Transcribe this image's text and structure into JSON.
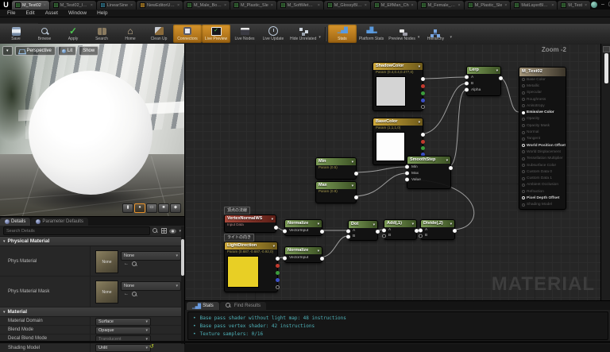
{
  "window": {
    "logo": "U",
    "tabs": [
      {
        "label": "M_Test02",
        "active": true
      },
      {
        "label": "M_Test02_Inst",
        "active": false
      },
      {
        "label": "LinearSine",
        "active": false
      },
      {
        "label": "NewEditorUtility",
        "active": false
      },
      {
        "label": "M_Male_Body",
        "active": false
      },
      {
        "label": "M_Plastic_Sle",
        "active": false
      },
      {
        "label": "M_SoftMetal_+",
        "active": false
      },
      {
        "label": "M_GlossyBla+",
        "active": false
      },
      {
        "label": "M_ElfMan_Ch",
        "active": false
      },
      {
        "label": "M_Female_Bo+",
        "active": false
      },
      {
        "label": "M_Plastic_Sle",
        "active": false
      },
      {
        "label": "MatLayerBlend",
        "active": false
      },
      {
        "label": "M_Test",
        "active": false
      }
    ],
    "menu": [
      {
        "label": "File"
      },
      {
        "label": "Edit"
      },
      {
        "label": "Asset"
      },
      {
        "label": "Window"
      },
      {
        "label": "Help"
      }
    ],
    "toolbar_tab": "Toolbar",
    "toolbar": [
      {
        "label": "Save"
      },
      {
        "label": "Browse"
      },
      {
        "label": "Apply"
      },
      {
        "label": "Search"
      },
      {
        "label": "Home"
      },
      {
        "label": "Clean Up"
      },
      {
        "label": "Connectors",
        "active": true
      },
      {
        "label": "Live Preview",
        "active": true
      },
      {
        "label": "Live Nodes"
      },
      {
        "label": "Live Update"
      },
      {
        "label": "Hide Unrelated"
      },
      {
        "label": "Stats",
        "active": true
      },
      {
        "label": "Platform Stats"
      },
      {
        "label": "Preview Nodes"
      },
      {
        "label": "Hierarchy"
      }
    ]
  },
  "viewport": {
    "buttons": {
      "perspective": "Perspective",
      "lit": "Lit",
      "show": "Show"
    }
  },
  "details": {
    "tabs": [
      {
        "label": "Details",
        "active": true
      },
      {
        "label": "Parameter Defaults",
        "active": false
      }
    ],
    "search_placeholder": "Search Details",
    "sections": [
      {
        "header": "Physical Material"
      },
      {
        "header": "Material"
      }
    ],
    "phys_rows": [
      {
        "label": "Phys Material",
        "thumb": "None",
        "value": "None"
      },
      {
        "label": "Phys Material Mask",
        "thumb": "None",
        "value": "None"
      }
    ],
    "mat_rows": [
      {
        "label": "Material Domain",
        "value": "Surface"
      },
      {
        "label": "Blend Mode",
        "value": "Opaque"
      },
      {
        "label": "Decal Blend Mode",
        "value": "Translucent"
      },
      {
        "label": "Shading Model",
        "value": "Unlit"
      }
    ]
  },
  "graph": {
    "zoom_label": "Zoom -2",
    "watermark": "MATERIAL",
    "comments": {
      "vertex_normal": "頂点の法線",
      "light_direction": "ライトの向き"
    },
    "nodes": {
      "shadow_color": {
        "title": "ShadowColor",
        "subtitle": "Param (0.4,0.4,0.477,0)"
      },
      "lerp": {
        "title": "Lerp",
        "pins": [
          "A",
          "B",
          "Alpha"
        ]
      },
      "base_color": {
        "title": "BaseColor",
        "subtitle": "Param (1,1,1,0)"
      },
      "min": {
        "title": "Min",
        "subtitle": "Param (0.5)"
      },
      "max": {
        "title": "Max",
        "subtitle": "Param (0.9)"
      },
      "smoothstep": {
        "title": "SmoothStep",
        "pins": [
          "Min",
          "Max",
          "Value"
        ]
      },
      "vertex_normal": {
        "title": "VertexNormalWS",
        "subtitle": "Input Data"
      },
      "normalize1": {
        "title": "Normalize",
        "pin": "VectorInput"
      },
      "dot": {
        "title": "Dot",
        "pins": [
          "A",
          "B"
        ]
      },
      "add": {
        "title": "Add(,1)",
        "pins": [
          "A",
          "B"
        ]
      },
      "divide": {
        "title": "Divide(,2)",
        "pins": [
          "A",
          "B"
        ]
      },
      "light_direction": {
        "title": "LightDirection",
        "subtitle": "Param (0.687,-0.687,-0.92,0)"
      },
      "normalize2": {
        "title": "Normalize",
        "pin": "VectorInput"
      }
    },
    "output_node": {
      "title": "M_Test02",
      "pins": [
        {
          "label": "Base Color",
          "state": "off"
        },
        {
          "label": "Metallic",
          "state": "off"
        },
        {
          "label": "Specular",
          "state": "off"
        },
        {
          "label": "Roughness",
          "state": "off"
        },
        {
          "label": "Anisotropy",
          "state": "off"
        },
        {
          "label": "Emissive Color",
          "state": "on"
        },
        {
          "label": "Opacity",
          "state": "off"
        },
        {
          "label": "Opacity Mask",
          "state": "off"
        },
        {
          "label": "Normal",
          "state": "off"
        },
        {
          "label": "Tangent",
          "state": "off"
        },
        {
          "label": "World Position Offset",
          "state": "enabled"
        },
        {
          "label": "World Displacement",
          "state": "off"
        },
        {
          "label": "Tessellation Multiplier",
          "state": "off"
        },
        {
          "label": "Subsurface Color",
          "state": "off"
        },
        {
          "label": "Custom Data 0",
          "state": "off"
        },
        {
          "label": "Custom Data 1",
          "state": "off"
        },
        {
          "label": "Ambient Occlusion",
          "state": "off"
        },
        {
          "label": "Refraction",
          "state": "off"
        },
        {
          "label": "Pixel Depth Offset",
          "state": "enabled"
        },
        {
          "label": "Shading Model",
          "state": "off"
        }
      ]
    }
  },
  "stats": {
    "tabs": [
      {
        "label": "Stats",
        "active": true
      },
      {
        "label": "Find Results",
        "active": false
      }
    ],
    "lines": [
      "Base pass shader without light map: 48 instructions",
      "Base pass vertex shader: 42 instructions",
      "Texture samplers: 0/16"
    ]
  }
}
